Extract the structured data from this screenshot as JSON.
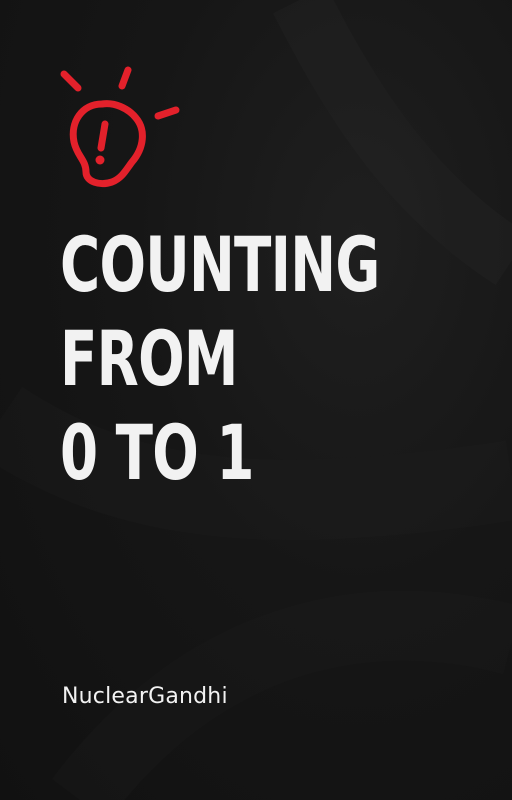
{
  "cover": {
    "title_lines": [
      "COUNTING",
      "FROM",
      "0 TO 1"
    ],
    "author": "NuclearGandhi",
    "icon": "lightbulb-exclamation-icon",
    "colors": {
      "background": "#141414",
      "text": "#f2f2f2",
      "accent": "#e3212b"
    }
  }
}
